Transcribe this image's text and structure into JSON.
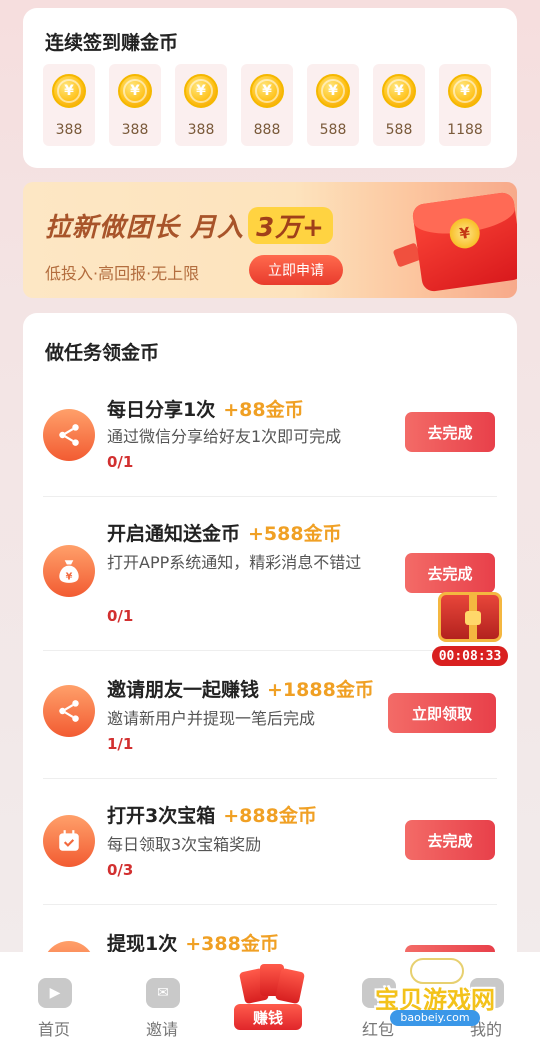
{
  "signin": {
    "title": "连续签到赚金币",
    "days": [
      {
        "amount": "388"
      },
      {
        "amount": "388"
      },
      {
        "amount": "388"
      },
      {
        "amount": "888"
      },
      {
        "amount": "588"
      },
      {
        "amount": "588"
      },
      {
        "amount": "1188"
      }
    ],
    "coin_symbol": "¥"
  },
  "banner": {
    "title_main": "拉新做团长 月入",
    "title_highlight": "3万+",
    "subtitle": "低投入·高回报·无上限",
    "button": "立即申请",
    "packet_symbol": "¥"
  },
  "tasks": {
    "title": "做任务领金币",
    "items": [
      {
        "name": "每日分享1次",
        "reward": "+88金币",
        "desc": "通过微信分享给好友1次即可完成",
        "progress": "0/1",
        "button": "去完成",
        "icon": "share-icon"
      },
      {
        "name": "开启通知送金币",
        "reward": "+588金币",
        "desc": "打开APP系统通知，精彩消息不错过",
        "progress": "0/1",
        "button": "去完成",
        "icon": "money-bag-icon"
      },
      {
        "name": "邀请朋友一起赚钱",
        "reward": "+1888金币",
        "desc": "邀请新用户并提现一笔后完成",
        "progress": "1/1",
        "button": "立即领取",
        "icon": "share-icon"
      },
      {
        "name": "打开3次宝箱",
        "reward": "+888金币",
        "desc": "每日领取3次宝箱奖励",
        "progress": "0/3",
        "button": "去完成",
        "icon": "calendar-check-icon"
      },
      {
        "name": "提现1次",
        "reward": "+388金币",
        "desc": "",
        "progress": "",
        "button": "",
        "icon": "withdraw-icon"
      }
    ]
  },
  "chest": {
    "timer": "00:08:33"
  },
  "nav": {
    "items": [
      {
        "label": "首页",
        "icon": "play-icon"
      },
      {
        "label": "邀请",
        "icon": "envelope-icon"
      },
      {
        "label": "赚钱",
        "icon": "red-packet-icon"
      },
      {
        "label": "红包",
        "icon": "wallet-icon"
      },
      {
        "label": "我的",
        "icon": "user-icon"
      }
    ]
  },
  "watermark": {
    "text": "宝贝游戏网",
    "url": "baobeiy.com"
  },
  "colors": {
    "accent": "#e8404a",
    "reward": "#f0a024",
    "progress": "#d23030"
  }
}
